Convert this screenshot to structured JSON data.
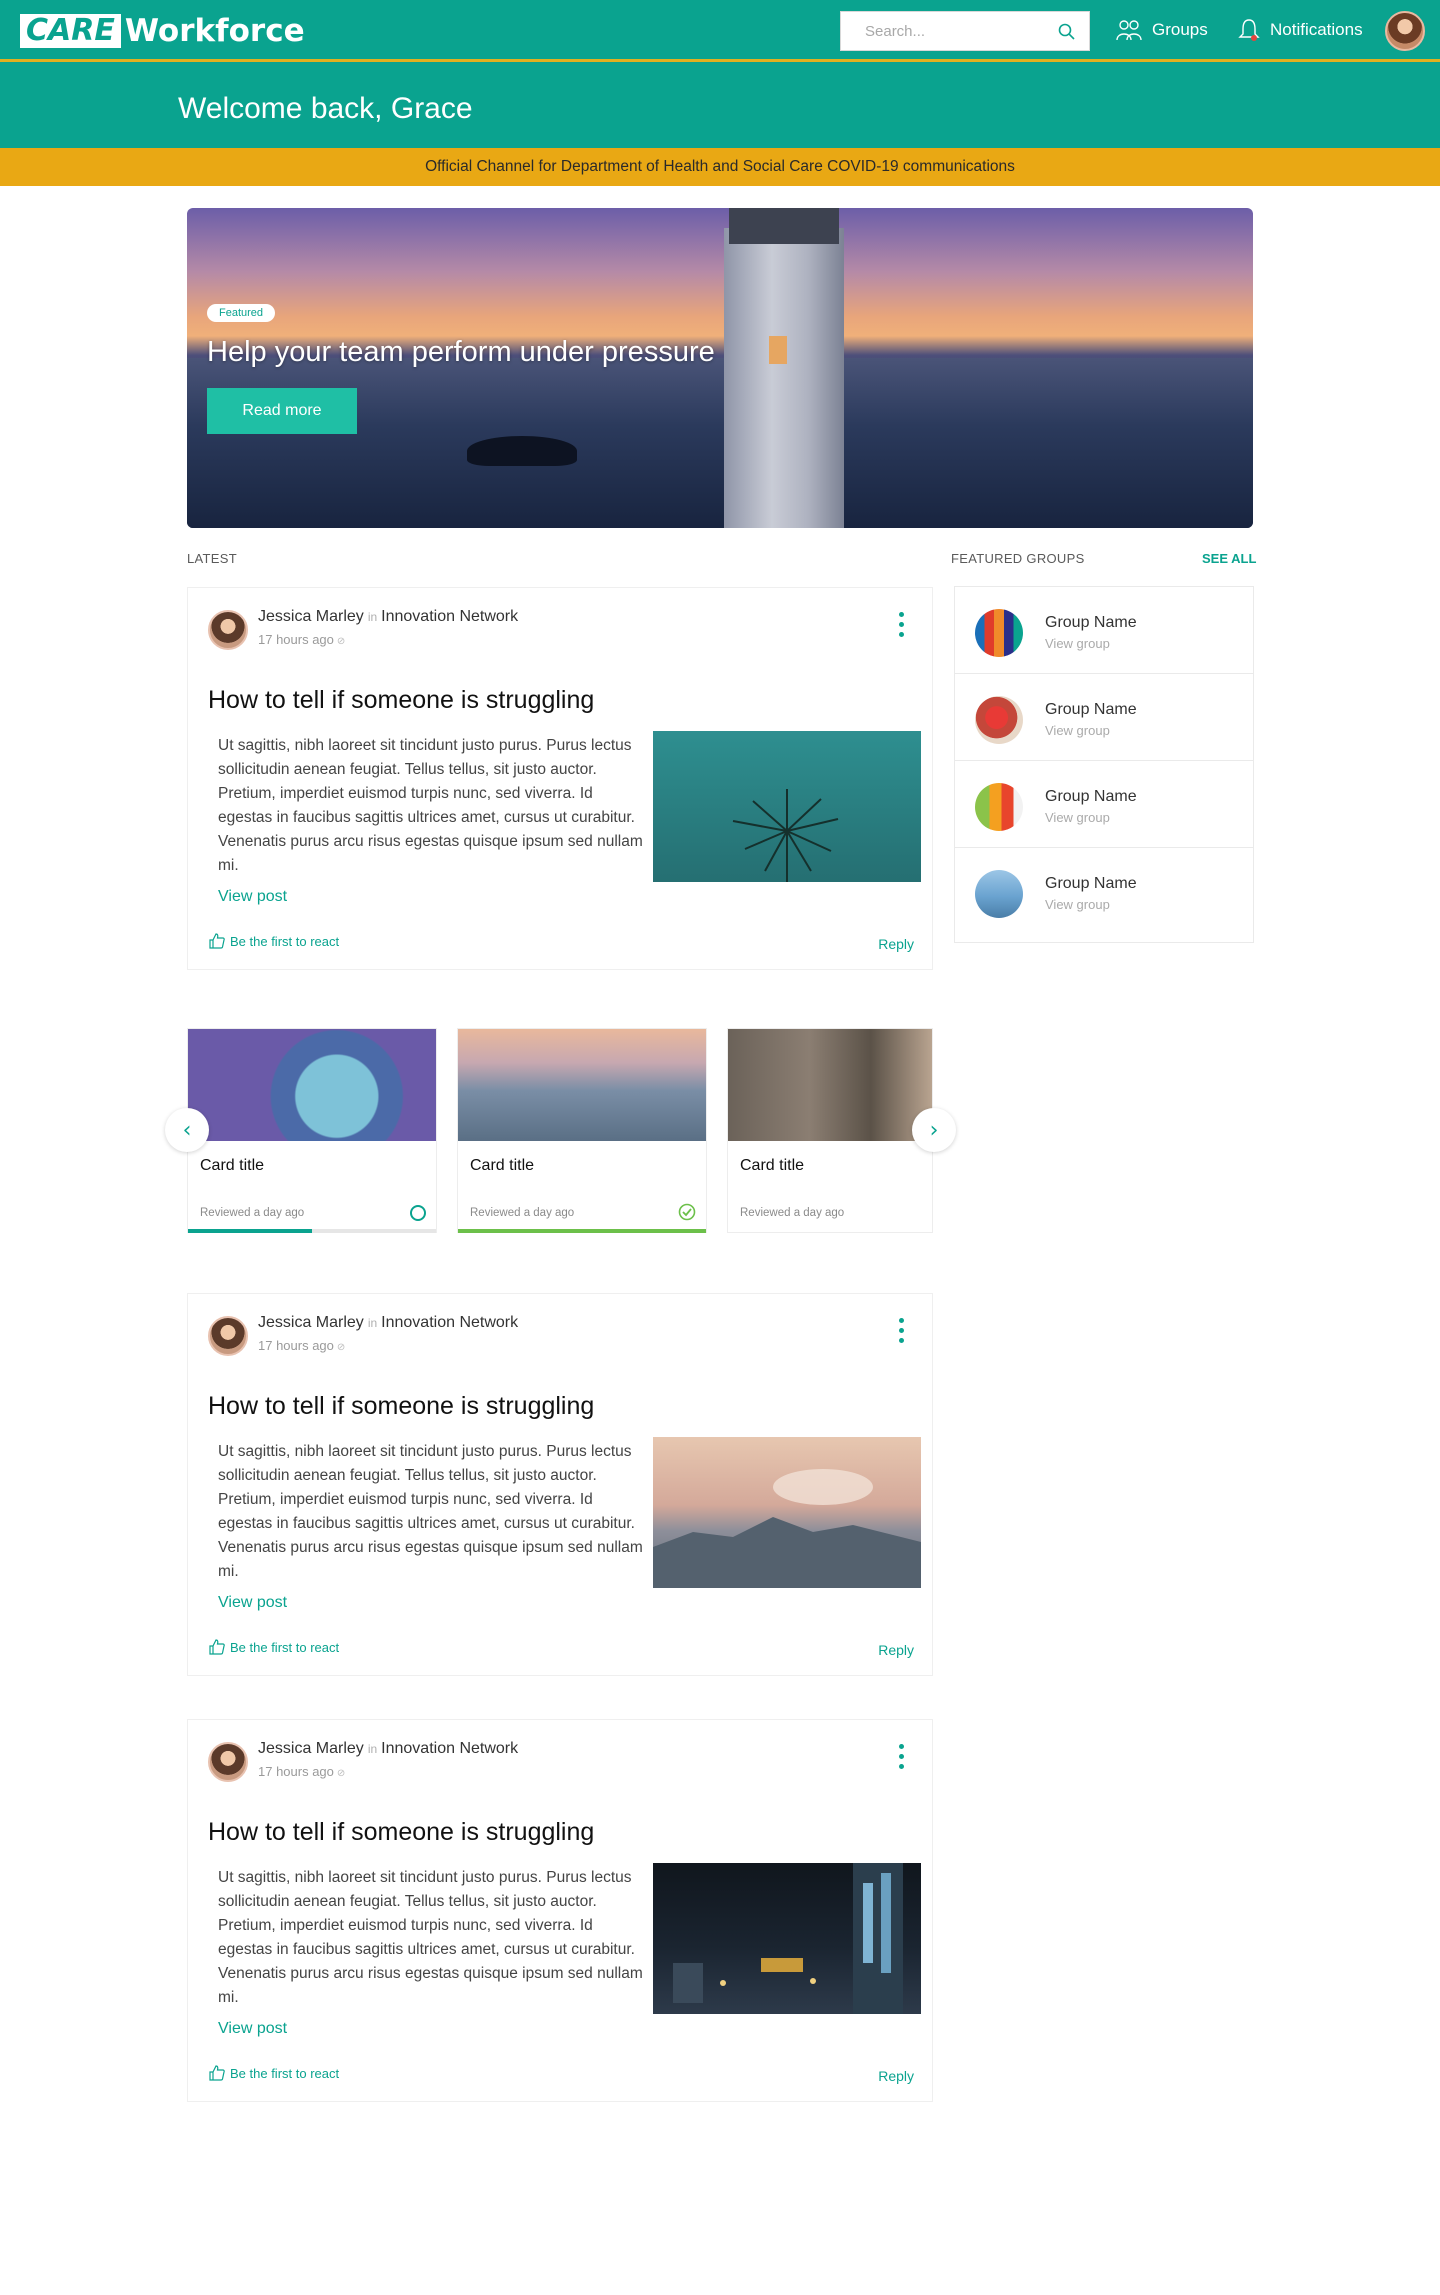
{
  "header": {
    "logo_box": "CARE",
    "logo_text": "Workforce",
    "search_placeholder": "Search...",
    "nav_groups": "Groups",
    "nav_notifications": "Notifications"
  },
  "welcome": "Welcome back, Grace",
  "banner": "Official Channel for Department of Health and Social Care COVID-19 communications",
  "hero": {
    "badge": "Featured",
    "title": "Help your team perform under pressure",
    "button": "Read more"
  },
  "sections": {
    "latest": "LATEST",
    "featured_groups": "FEATURED GROUPS",
    "see_all": "SEE ALL"
  },
  "posts": [
    {
      "author": "Jessica Marley",
      "in": "in",
      "network": "Innovation Network",
      "time": "17 hours ago",
      "title": "How to tell if someone is struggling",
      "body": "Ut sagittis, nibh laoreet sit tincidunt justo purus. Purus lectus sollicitudin aenean feugiat. Tellus tellus, sit justo auctor. Pretium, imperdiet euismod turpis nunc, sed viverra. Id egestas in faucibus sagittis ultrices amet, cursus ut curabitur. Venenatis purus arcu risus egestas quisque ipsum sed nullam mi.",
      "link": "View post",
      "react": "Be the first to react",
      "reply": "Reply"
    },
    {
      "author": "Jessica Marley",
      "in": "in",
      "network": "Innovation Network",
      "time": "17 hours ago",
      "title": "How to tell if someone is struggling",
      "body": "Ut sagittis, nibh laoreet sit tincidunt justo purus. Purus lectus sollicitudin aenean feugiat. Tellus tellus, sit justo auctor. Pretium, imperdiet euismod turpis nunc, sed viverra. Id egestas in faucibus sagittis ultrices amet, cursus ut curabitur. Venenatis purus arcu risus egestas quisque ipsum sed nullam mi.",
      "link": "View post",
      "react": "Be the first to react",
      "reply": "Reply"
    },
    {
      "author": "Jessica Marley",
      "in": "in",
      "network": "Innovation Network",
      "time": "17 hours ago",
      "title": "How to tell if someone is struggling",
      "body": "Ut sagittis, nibh laoreet sit tincidunt justo purus. Purus lectus sollicitudin aenean feugiat. Tellus tellus, sit justo auctor. Pretium, imperdiet euismod turpis nunc, sed viverra. Id egestas in faucibus sagittis ultrices amet, cursus ut curabitur. Venenatis purus arcu risus egestas quisque ipsum sed nullam mi.",
      "link": "View post",
      "react": "Be the first to react",
      "reply": "Reply"
    }
  ],
  "groups": [
    {
      "name": "Group Name",
      "sub": "View group"
    },
    {
      "name": "Group Name",
      "sub": "View group"
    },
    {
      "name": "Group Name",
      "sub": "View group"
    },
    {
      "name": "Group Name",
      "sub": "View group"
    }
  ],
  "cards": [
    {
      "title": "Card title",
      "meta": "Reviewed a day ago",
      "progress": 0.5,
      "status": "in-progress"
    },
    {
      "title": "Card title",
      "meta": "Reviewed a day ago",
      "progress": 1.0,
      "status": "complete"
    },
    {
      "title": "Card title",
      "meta": "Reviewed a day ago",
      "progress": 0.0,
      "status": "none"
    }
  ],
  "colors": {
    "brand": "#0aa38f",
    "banner": "#e9a814",
    "button": "#1fbfa5",
    "complete": "#6cc04a"
  },
  "icons": {
    "search": "search-icon",
    "groups": "groups-icon",
    "notifications": "bell-icon",
    "kebab": "kebab-menu-icon",
    "react": "thumbs-up-icon",
    "prev": "chevron-left-icon",
    "next": "chevron-right-icon"
  }
}
